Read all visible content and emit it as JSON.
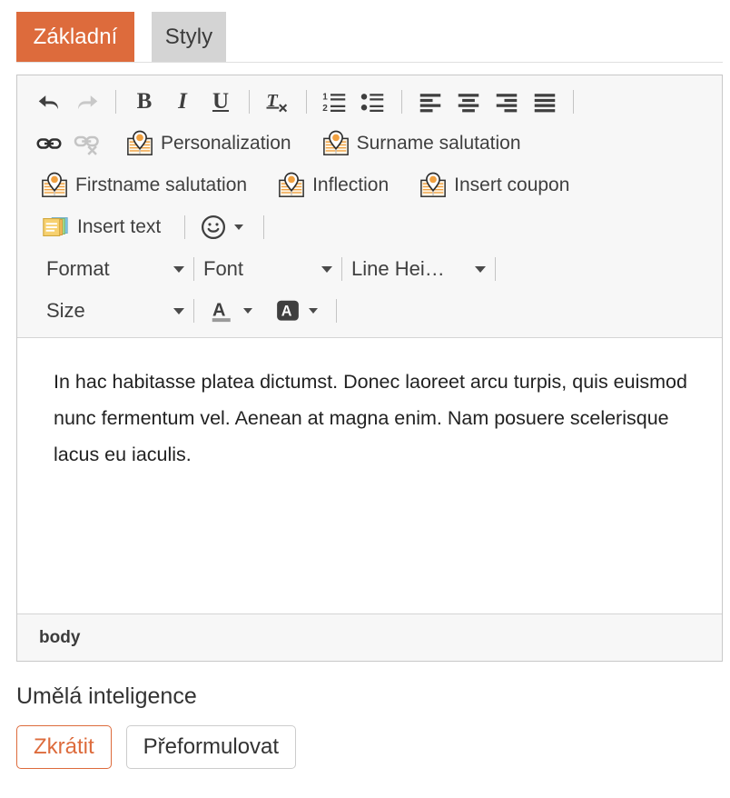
{
  "tabs": [
    {
      "label": "Základní",
      "active": true
    },
    {
      "label": "Styly",
      "active": false
    }
  ],
  "colors": {
    "accent": "#dd6b3c",
    "tab_inactive_bg": "#d4d4d4",
    "toolbar_bg": "#f7f7f7",
    "panel_border": "#c8c8c8",
    "text": "#333333",
    "icon": "#3f3f3f",
    "icon_disabled": "#c4c4c4",
    "pin_orange": "#f0a040",
    "note_yellow": "#f5cf60"
  },
  "toolbar": {
    "row1": {
      "undo": {
        "icon": "undo-icon",
        "title": "Undo",
        "disabled": false
      },
      "redo": {
        "icon": "redo-icon",
        "title": "Redo",
        "disabled": true
      },
      "bold": {
        "icon": "bold-icon",
        "glyph": "B",
        "title": "Bold"
      },
      "italic": {
        "icon": "italic-icon",
        "glyph": "I",
        "title": "Italic"
      },
      "underline": {
        "icon": "underline-icon",
        "glyph": "U",
        "title": "Underline"
      },
      "remove_format": {
        "icon": "remove-format-icon",
        "glyph": "T",
        "title": "Remove Format"
      },
      "numbered_list": {
        "icon": "numbered-list-icon",
        "title": "Insert/Remove Numbered List"
      },
      "bulleted_list": {
        "icon": "bulleted-list-icon",
        "title": "Insert/Remove Bulleted List"
      },
      "align_left": {
        "icon": "align-left-icon",
        "title": "Align Left"
      },
      "align_center": {
        "icon": "align-center-icon",
        "title": "Center"
      },
      "align_right": {
        "icon": "align-right-icon",
        "title": "Align Right"
      },
      "align_justify": {
        "icon": "align-justify-icon",
        "title": "Justify"
      }
    },
    "row2": {
      "link": {
        "icon": "link-icon",
        "title": "Link",
        "disabled": false
      },
      "unlink": {
        "icon": "unlink-icon",
        "title": "Unlink",
        "disabled": true
      },
      "personalization": {
        "icon": "map-marker-icon",
        "label": "Personalization"
      },
      "surname_salutation": {
        "icon": "map-marker-icon",
        "label": "Surname salutation"
      }
    },
    "row3": {
      "firstname_salutation": {
        "icon": "map-marker-icon",
        "label": "Firstname salutation"
      },
      "inflection": {
        "icon": "map-marker-icon",
        "label": "Inflection"
      },
      "insert_coupon": {
        "icon": "map-marker-icon",
        "label": "Insert coupon"
      }
    },
    "row4": {
      "insert_text": {
        "icon": "sticky-notes-icon",
        "label": "Insert text"
      },
      "emoji": {
        "icon": "smiley-icon",
        "label": ""
      }
    },
    "row5": {
      "format": {
        "label": "Format"
      },
      "font": {
        "label": "Font"
      },
      "line_height": {
        "label": "Line Hei…"
      }
    },
    "row6": {
      "size": {
        "label": "Size"
      },
      "text_color": {
        "icon": "text-color-icon",
        "glyph": "A"
      },
      "background_color": {
        "icon": "background-color-icon",
        "glyph": "A"
      }
    }
  },
  "editor": {
    "body_text": "In hac habitasse platea dictumst. Donec laoreet arcu turpis, quis euismod nunc fermentum vel. Aenean at magna enim. Nam posuere scelerisque lacus eu iaculis."
  },
  "path_bar": {
    "items": [
      "body"
    ]
  },
  "ai_section": {
    "title": "Umělá inteligence",
    "buttons": [
      {
        "label": "Zkrátit",
        "style": "primary-outline"
      },
      {
        "label": "Přeformulovat",
        "style": "default"
      }
    ]
  }
}
